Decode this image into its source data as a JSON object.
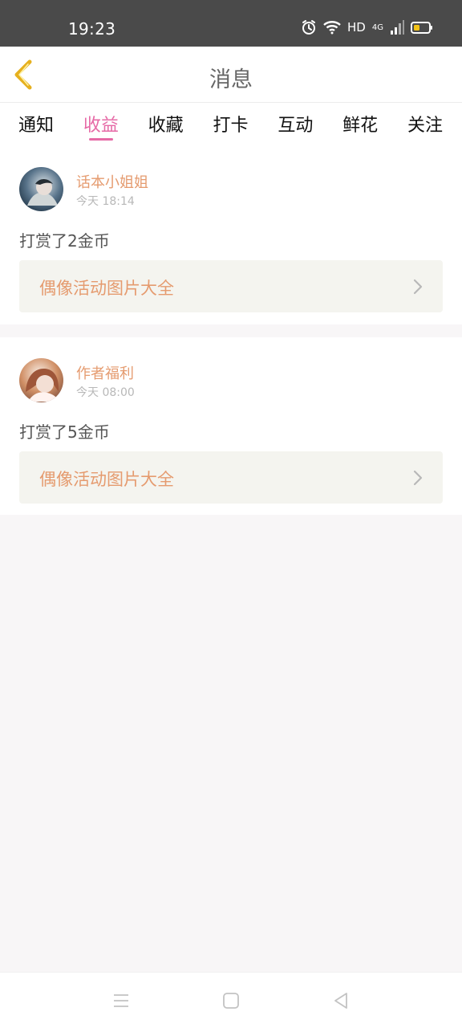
{
  "status_bar": {
    "time": "19:23",
    "network": "HD",
    "network_type": "4G",
    "battery_color": "#f3c316"
  },
  "header": {
    "title": "消息",
    "accent_color": "#e6b01e"
  },
  "tabs": [
    {
      "label": "通知",
      "active": false
    },
    {
      "label": "收益",
      "active": true
    },
    {
      "label": "收藏",
      "active": false
    },
    {
      "label": "打卡",
      "active": false
    },
    {
      "label": "互动",
      "active": false
    },
    {
      "label": "鲜花",
      "active": false
    },
    {
      "label": "关注",
      "active": false
    }
  ],
  "messages": [
    {
      "author": "话本小姐姐",
      "time": "今天 18:14",
      "text": "打赏了2金币",
      "link": "偶像活动图片大全"
    },
    {
      "author": "作者福利",
      "time": "今天 08:00",
      "text": "打赏了5金币",
      "link": "偶像活动图片大全"
    }
  ],
  "colors": {
    "active_tab": "#e66aa6",
    "author": "#e59b6f",
    "link_background": "#f4f4ef"
  },
  "icons": {
    "back": "chevron-left-icon",
    "alarm": "alarm-icon",
    "wifi": "wifi-icon",
    "signal": "signal-icon",
    "battery": "battery-icon",
    "link_arrow": "chevron-right-icon",
    "nav_menu": "menu-icon",
    "nav_home": "home-icon",
    "nav_back": "back-triangle-icon"
  }
}
